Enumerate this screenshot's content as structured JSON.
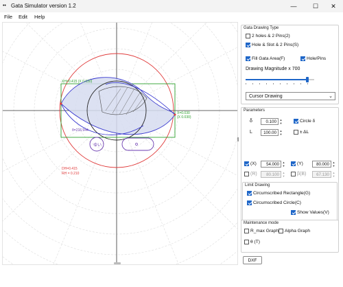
{
  "window": {
    "title": "Gata Simulator  version 1.2",
    "app_icon": "• •",
    "minimize": "—",
    "maximize": "☐",
    "close": "✕"
  },
  "menu": [
    "File",
    "Edit",
    "Help"
  ],
  "canvas": {
    "label_top": "XH=0.415 (X 0.030)",
    "label_right_1": "X=0.030",
    "label_right_2": "(X 0.030)",
    "label_angle": "θ=216.944",
    "label_pin": "ゆい",
    "label_dh": "DH=0.415",
    "label_rh": "RH = 0.210"
  },
  "panel": {
    "gata_type": {
      "title": "Gata Drawing Type",
      "opt1": "2 holes & 2 Pins(2)",
      "opt2": "Hole & Slot & 2 Pins(S)",
      "fill": "Fill Gata Area(F)",
      "holepins": "Hole/Pins",
      "magnitude": "Drawing Magnitude x 700",
      "magnitude_fraction": 0.9,
      "mode": "Cursor Drawing"
    },
    "parameters": {
      "title": "Parameters",
      "delta_sym": "δ",
      "delta_val": "0.100",
      "circle_delta": "Circle δ",
      "L_sym": "L",
      "L_val": "100.00",
      "pm_dl": "± ΔL",
      "x_label": "(X)",
      "x_val": "54.000",
      "y_label": "(Y)",
      "y_val": "80.000",
      "r_label": "(R)",
      "r_val": "80.100",
      "b_label": "β(B)",
      "b_val": "67.130",
      "limit_title": "Limit Drawing",
      "rect": "Circumscribed Rectangle(G)",
      "circle": "Circumscribed Circle(C)",
      "show": "Show Values(V)"
    },
    "maintenance": {
      "title": "Maintenance mode",
      "rmax": "R_max Graph",
      "alpha": "Alpha Graph",
      "theta": "θ (T)"
    },
    "dxf": "DXF"
  }
}
